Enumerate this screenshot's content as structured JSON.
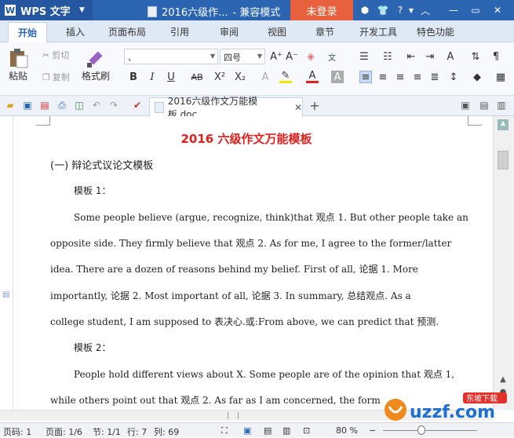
{
  "titlebar": {
    "app_name": "WPS 文字",
    "doc_title": "2016六级作...",
    "mode": "- 兼容模式",
    "login": "未登录"
  },
  "tabs": [
    "开始",
    "插入",
    "页面布局",
    "引用",
    "审阅",
    "视图",
    "章节",
    "开发工具",
    "特色功能"
  ],
  "ribbon": {
    "paste": "粘贴",
    "cut": "剪切",
    "copy": "复制",
    "format_painter": "格式刷",
    "font_name": "、",
    "font_size": "四号"
  },
  "doc_tab": {
    "name": "2016六级作文万能模板.doc"
  },
  "document": {
    "heading": "2016 六级作文万能模板",
    "lines": [
      "(一) 辩论式议论文模板",
      "模板 1：",
      "Some people believe (argue, recognize, think)that  观点 1. But other people take an",
      "opposite side. They firmly believe that  观点 2. As for me, I agree to the former/latter",
      "idea. There are a dozen of reasons behind my belief. First of all,  论据 1. More",
      "importantly,  论据 2. Most important of all,  论据 3. In summary,  总结观点. As a",
      "college student, I am supposed to  表决心.或:From above, we can predict that  预测.",
      "模板 2：",
      "People hold different views about X. Some people are of the opinion that  观点 1,",
      "while others point out that  观点 2. As far as I am concerned, the form"
    ]
  },
  "status": {
    "page_num": "页码: 1",
    "pages": "页面: 1/6",
    "section": "节: 1/1",
    "row": "行: 7",
    "col": "列: 69",
    "zoom": "80 %"
  },
  "watermark": {
    "text": "uzzf.com",
    "badge": "东坡下载"
  }
}
